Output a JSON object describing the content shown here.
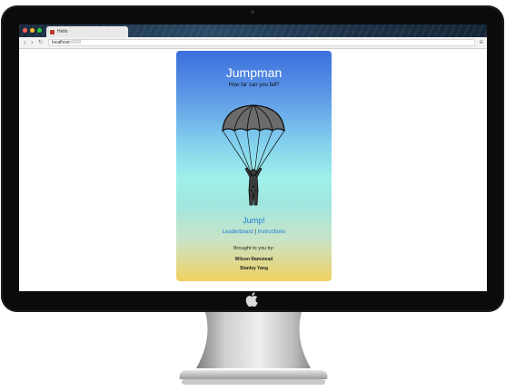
{
  "browser": {
    "tab_title": "Hello",
    "url_host": "localhost",
    "url_port": ":8000"
  },
  "app": {
    "title": "Jumpman",
    "subtitle": "How far can you fall?",
    "jump_label": "Jump!",
    "leaderboard_label": "Leaderboard",
    "separator": "|",
    "instructions_label": "Instructions",
    "credits_label": "Brought to you by:",
    "authors": [
      "Wilson Ramstead",
      "Stanley Yang"
    ]
  },
  "colors": {
    "link": "#1f7bd8",
    "gradient_top": "#3b6fdc",
    "gradient_middle": "#9ff0ea",
    "gradient_bottom": "#f1d161"
  },
  "icons": {
    "parachute": "parachute-icon",
    "apple": "apple-logo-icon"
  }
}
